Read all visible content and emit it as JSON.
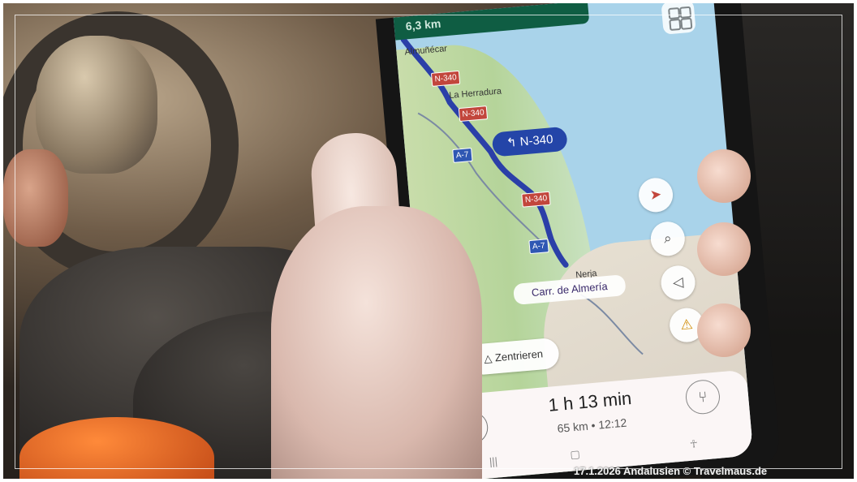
{
  "map": {
    "distance_banner": "6,3 km",
    "places": [
      "Almuñécar",
      "La Herradura",
      "Nerja"
    ],
    "road_shields": {
      "n340": "N-340",
      "a7": "A-7"
    },
    "turn_label": "N-340",
    "street_label": "Carr. de Almería"
  },
  "controls": {
    "compass_icon": "compass-icon",
    "search_icon": "search-icon",
    "sound_icon": "sound-icon",
    "warning_icon": "warning-icon",
    "recenter_label": "Zentrieren"
  },
  "trip": {
    "duration": "1 h 13 min",
    "distance": "65 km",
    "separator": "•",
    "arrival": "12:12"
  },
  "watermark": "17.1.2026 Andalusien © Travelmaus.de"
}
